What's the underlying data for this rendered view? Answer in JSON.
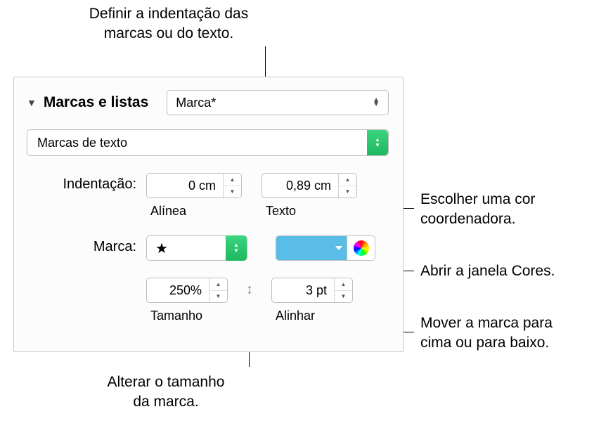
{
  "callouts": {
    "top": "Definir a indentação das\nmarcas ou do texto.",
    "color_swatch": "Escolher uma cor\ncoordenadora.",
    "color_picker": "Abrir a janela Cores.",
    "align": "Mover a marca para\ncima ou para baixo.",
    "size": "Alterar o tamanho\nda marca."
  },
  "section": {
    "title": "Marcas e listas",
    "list_style": "Marca*",
    "bullet_type": "Marcas de texto"
  },
  "indent": {
    "label": "Indentação:",
    "bullet_value": "0 cm",
    "bullet_sublabel": "Alínea",
    "text_value": "0,89 cm",
    "text_sublabel": "Texto"
  },
  "bullet": {
    "label": "Marca:",
    "char": "★"
  },
  "size": {
    "value": "250%",
    "sublabel": "Tamanho"
  },
  "align": {
    "value": "3 pt",
    "sublabel": "Alinhar"
  },
  "colors": {
    "swatch": "#5abde8"
  }
}
